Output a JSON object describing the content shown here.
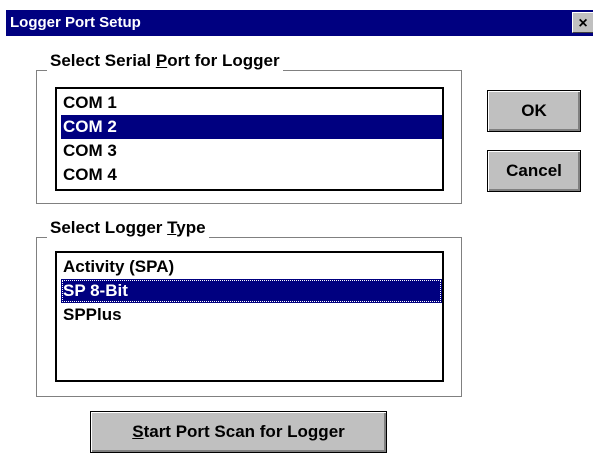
{
  "window": {
    "title": "Logger Port Setup",
    "close_label": "×"
  },
  "port_group": {
    "label_before": "Select Serial ",
    "label_mnemonic": "P",
    "label_after": "ort for Logger",
    "items": [
      "COM 1",
      "COM 2",
      "COM 3",
      "COM 4"
    ],
    "selected": "COM 2"
  },
  "type_group": {
    "label_before": "Select Logger ",
    "label_mnemonic": "T",
    "label_after": "ype",
    "items": [
      "Activity (SPA)",
      "SP 8-Bit",
      "SPPlus"
    ],
    "selected": "SP 8-Bit"
  },
  "buttons": {
    "ok_label": "OK",
    "cancel_label": "Cancel",
    "scan_mnemonic": "S",
    "scan_rest": "tart Port Scan for Logger"
  },
  "colors": {
    "title_bar": "#000080",
    "selection": "#000080",
    "button_face": "#c0c0c0"
  }
}
